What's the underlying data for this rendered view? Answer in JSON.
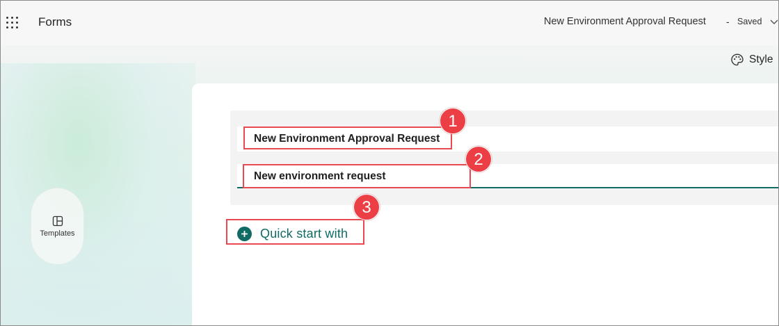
{
  "header": {
    "app_name": "Forms",
    "doc_title": "New Environment Approval Request",
    "separator": "-",
    "status": "Saved",
    "style_label": "Style"
  },
  "sidebar": {
    "templates_label": "Templates"
  },
  "form": {
    "title_value": "New Environment Approval Request",
    "description_value": "New environment request",
    "quick_start_label": "Quick start with"
  },
  "annotations": {
    "badge_1": "1",
    "badge_2": "2",
    "badge_3": "3"
  },
  "colors": {
    "accent": "#0f6b64",
    "annotation_red": "#ec3f45"
  },
  "icons": [
    "app-launcher-icon",
    "chevron-down-icon",
    "palette-icon",
    "templates-icon",
    "plus-icon"
  ]
}
